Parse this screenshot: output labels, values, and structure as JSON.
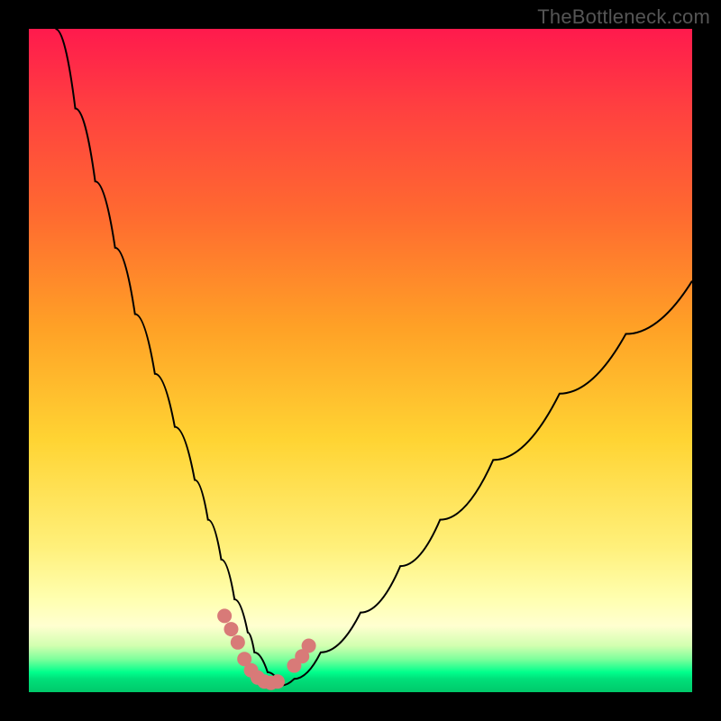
{
  "watermark": "TheBottleneck.com",
  "chart_data": {
    "type": "line",
    "title": "",
    "xlabel": "",
    "ylabel": "",
    "xlim": [
      0,
      100
    ],
    "ylim": [
      0,
      100
    ],
    "series": [
      {
        "name": "bottleneck-curve",
        "x": [
          4,
          7,
          10,
          13,
          16,
          19,
          22,
          25,
          27,
          29,
          31,
          33,
          34,
          36,
          38,
          40,
          44,
          50,
          56,
          62,
          70,
          80,
          90,
          100
        ],
        "values": [
          100,
          88,
          77,
          67,
          57,
          48,
          40,
          32,
          26,
          20,
          14,
          9,
          6,
          3,
          1,
          2,
          6,
          12,
          19,
          26,
          35,
          45,
          54,
          62
        ]
      }
    ],
    "markers": {
      "name": "highlight-points",
      "color": "#d87a78",
      "x": [
        29.5,
        30.5,
        31.5,
        32.5,
        33.5,
        34.5,
        35.5,
        36.5,
        37.5,
        40.0,
        41.2,
        42.2
      ],
      "values": [
        11.5,
        9.5,
        7.5,
        5.0,
        3.3,
        2.2,
        1.6,
        1.4,
        1.6,
        4.0,
        5.4,
        7.0
      ]
    },
    "background_gradient": {
      "top": "#ff1a4d",
      "mid": "#ffd633",
      "green_band_start_pct": 93,
      "bottom": "#00c96a"
    }
  }
}
